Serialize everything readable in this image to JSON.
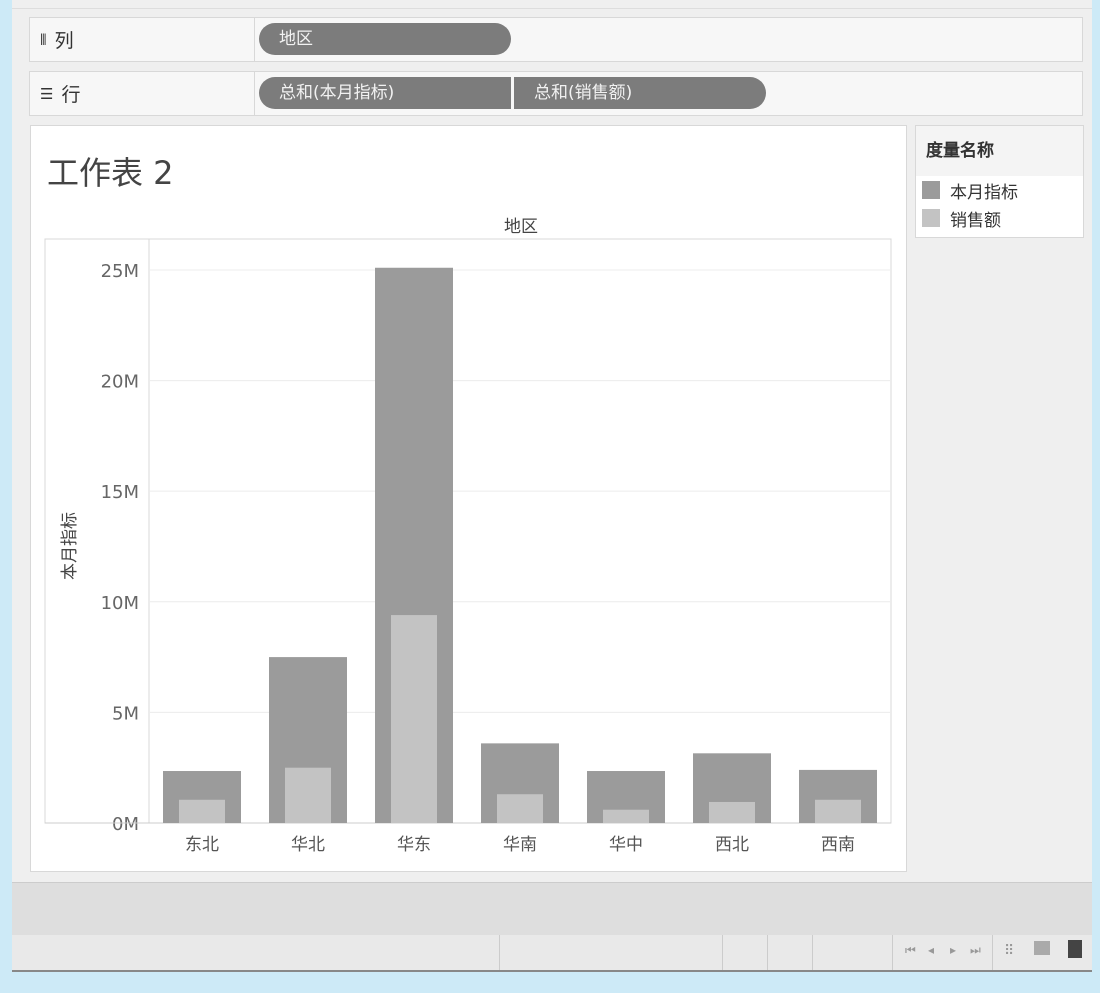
{
  "shelves": {
    "columns": {
      "label": "列",
      "pills": [
        "地区"
      ]
    },
    "rows": {
      "label": "行",
      "pills": [
        "总和(本月指标)",
        "总和(销售额)"
      ]
    }
  },
  "sheet_title": "工作表 2",
  "legend": {
    "title": "度量名称",
    "items": [
      {
        "label": "本月指标",
        "color": "#9b9b9b"
      },
      {
        "label": "销售额",
        "color": "#c3c3c3"
      }
    ]
  },
  "chart_data": {
    "type": "bar",
    "title": "工作表 2",
    "xlabel": "地区",
    "ylabel": "本月指标",
    "categories": [
      "东北",
      "华北",
      "华东",
      "华南",
      "华中",
      "西北",
      "西南"
    ],
    "series": [
      {
        "name": "本月指标",
        "color": "#9b9b9b",
        "values": [
          2.35,
          7.5,
          25.1,
          3.6,
          2.35,
          3.15,
          2.4
        ]
      },
      {
        "name": "销售额",
        "color": "#c3c3c3",
        "values": [
          1.05,
          2.5,
          9.4,
          1.3,
          0.6,
          0.95,
          1.05
        ]
      }
    ],
    "yunit": "M",
    "ylim": [
      0,
      26.4
    ],
    "yticks": [
      0,
      5,
      10,
      15,
      20,
      25
    ],
    "ytick_labels": [
      "0M",
      "5M",
      "10M",
      "15M",
      "20M",
      "25M"
    ],
    "grid": true,
    "legend_position": "right"
  }
}
